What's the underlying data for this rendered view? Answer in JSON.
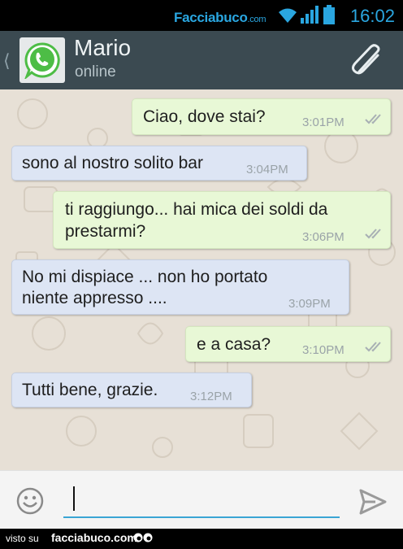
{
  "status_bar": {
    "brand": "Facciabuco",
    "brand_suffix": ".com",
    "clock": "16:02",
    "icons": [
      "wifi-icon",
      "signal-icon",
      "battery-icon"
    ],
    "accent_color": "#2aa6e0"
  },
  "header": {
    "contact_name": "Mario",
    "contact_status": "online",
    "background_color": "#3b4a51"
  },
  "messages": [
    {
      "direction": "out",
      "text": "Ciao, dove stai?",
      "time": "3:01PM",
      "status": "read"
    },
    {
      "direction": "in",
      "text": "sono al nostro solito bar",
      "time": "3:04PM"
    },
    {
      "direction": "out",
      "text": "ti raggiungo... hai mica dei soldi da prestarmi?",
      "text_line1": "ti raggiungo... hai mica dei soldi da",
      "text_line2": "prestarmi?",
      "time": "3:06PM",
      "status": "read"
    },
    {
      "direction": "in",
      "text": "No mi dispiace ... non ho portato niente appresso ....",
      "text_line1": "No mi dispiace ... non ho portato",
      "text_line2": "niente appresso ....",
      "time": "3:09PM"
    },
    {
      "direction": "out",
      "text": "e a casa?",
      "time": "3:10PM",
      "status": "read"
    },
    {
      "direction": "in",
      "text": "Tutti bene, grazie.",
      "time": "3:12PM"
    }
  ],
  "composer": {
    "value": "",
    "placeholder": ""
  },
  "footer": {
    "visto_label": "visto su",
    "site": "facciabuco.com"
  }
}
